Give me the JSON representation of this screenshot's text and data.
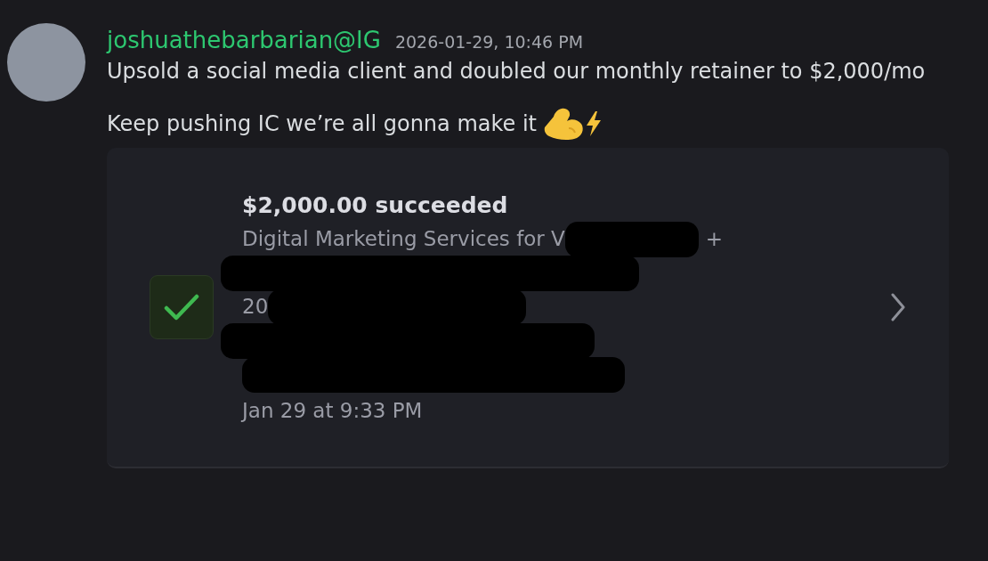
{
  "message": {
    "author": "joshuathebarbarian@IG",
    "timestamp": "2026-01-29, 10:46 PM",
    "paragraphs": [
      "Upsold a social media client and doubled our monthly retainer to $2,000/mo",
      "Keep pushing IC we’re all gonna make it"
    ]
  },
  "embed": {
    "title": "$2,000.00 succeeded",
    "succeeded": true,
    "lines": [
      {
        "text": "Digital Marketing Services for V",
        "suffix": "+",
        "redacted": true
      },
      {
        "redacted": true
      },
      {
        "text": "20",
        "redacted": true
      },
      {
        "redacted": true
      },
      {
        "redacted": true
      }
    ],
    "date": "Jan 29 at 9:33 PM"
  }
}
